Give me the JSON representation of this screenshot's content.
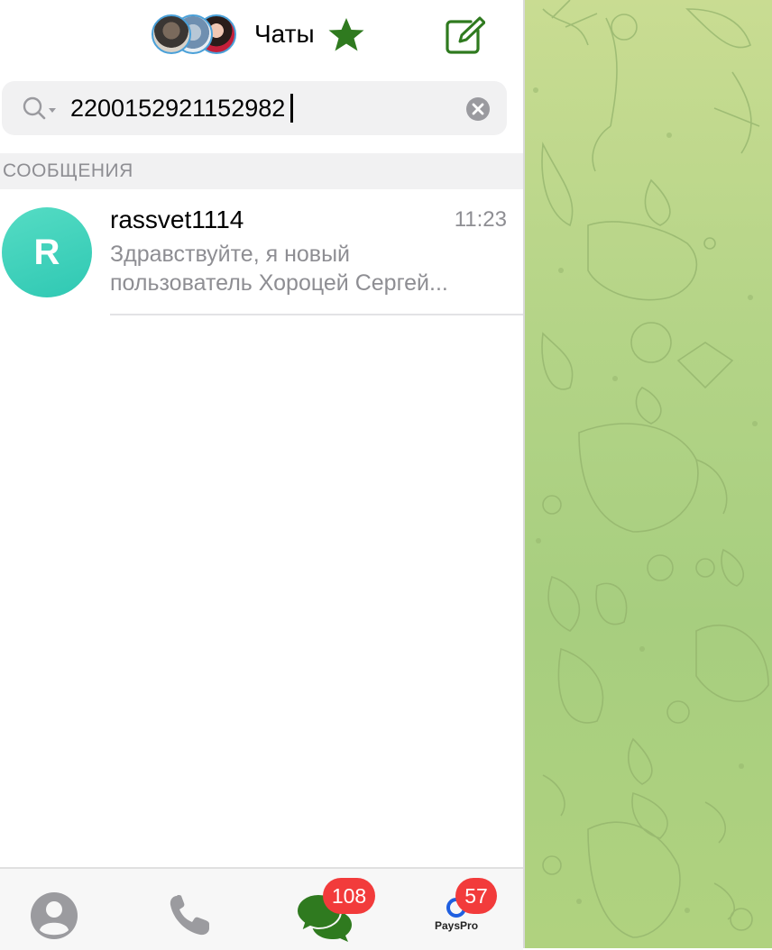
{
  "header": {
    "title": "Чаты"
  },
  "search": {
    "query": "2200152921152982"
  },
  "section": {
    "label": "СООБЩЕНИЯ"
  },
  "chats": [
    {
      "avatar_letter": "R",
      "name": "rassvet1114",
      "time": "11:23",
      "preview": "Здравствуйте, я новый\nпользователь  Хороцей Сергей..."
    }
  ],
  "tabbar": {
    "chats_badge": "108",
    "pays_badge": "57",
    "pays_label": "PaysPro"
  },
  "colors": {
    "accent_green": "#2f7a1f",
    "badge_red": "#f23b3b",
    "avatar_teal": "#3ccdb7",
    "wallpaper": "#b4d487"
  },
  "icons": [
    "star-icon",
    "compose-icon",
    "search-icon",
    "clear-icon",
    "contacts-icon",
    "calls-icon",
    "chats-icon",
    "payspro-icon"
  ]
}
